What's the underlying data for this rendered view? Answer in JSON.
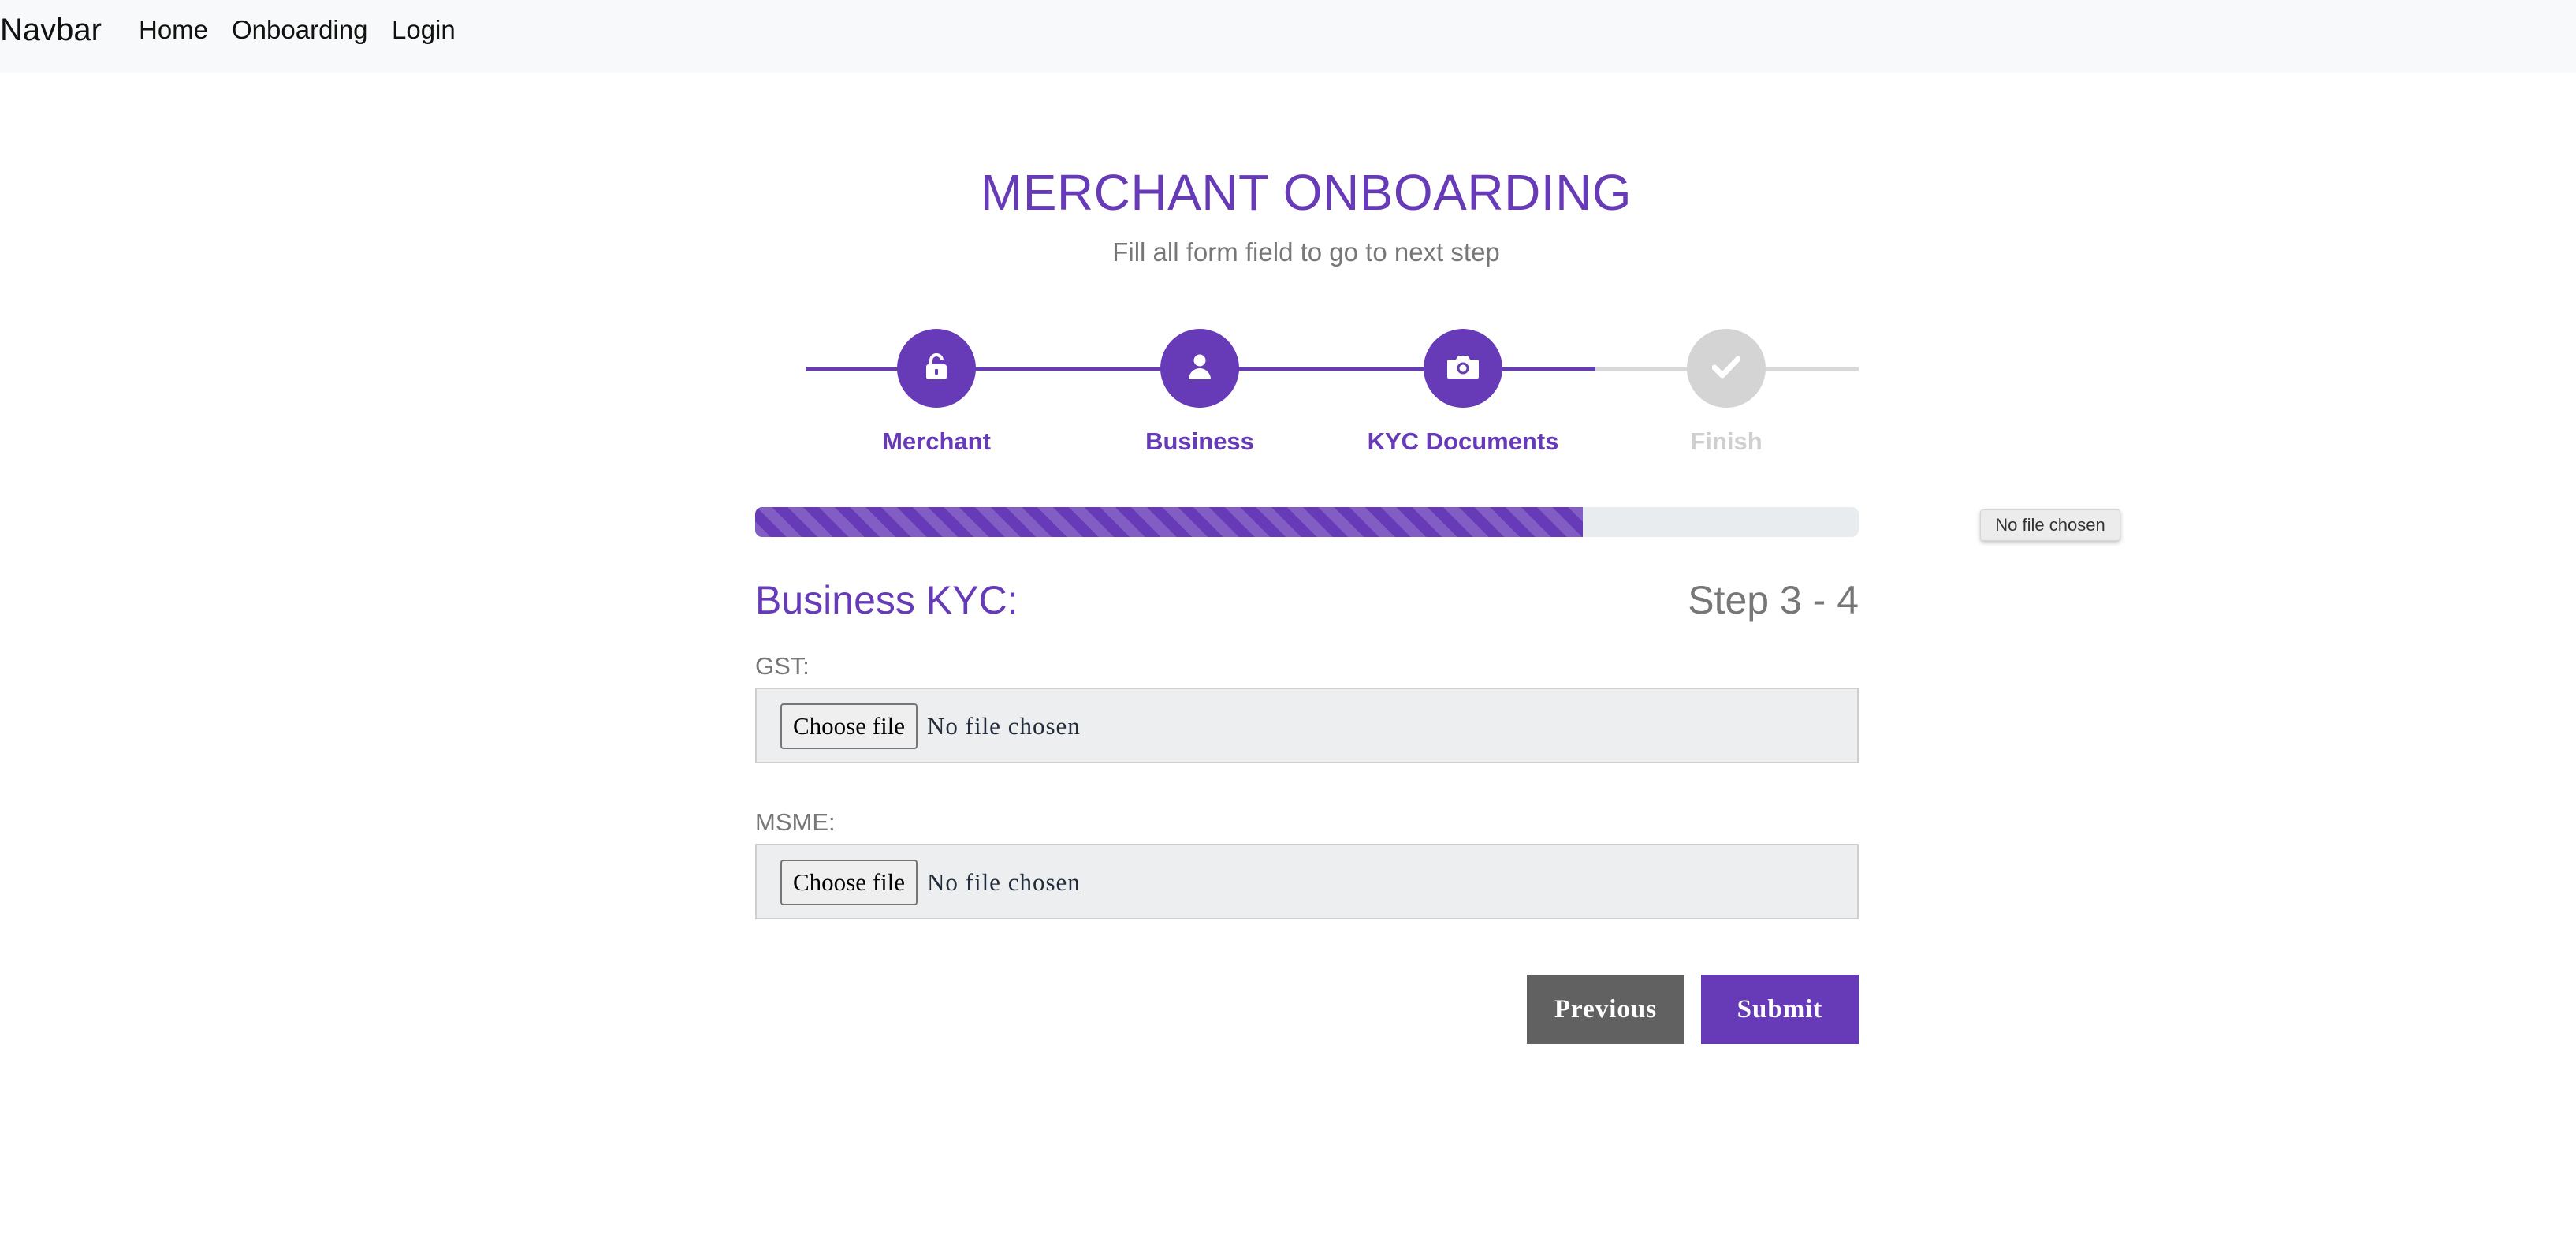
{
  "navbar": {
    "brand": "Navbar",
    "links": [
      "Home",
      "Onboarding",
      "Login"
    ]
  },
  "header": {
    "title": "MERCHANT ONBOARDING",
    "subtitle": "Fill all form field to go to next step"
  },
  "steps": [
    {
      "label": "Merchant",
      "icon": "unlock-icon",
      "status": "done"
    },
    {
      "label": "Business",
      "icon": "user-icon",
      "status": "done"
    },
    {
      "label": "KYC Documents",
      "icon": "camera-icon",
      "status": "done"
    },
    {
      "label": "Finish",
      "icon": "check-icon",
      "status": "todo"
    }
  ],
  "progress": {
    "percent": 75
  },
  "tooltip": "No file chosen",
  "section": {
    "title": "Business KYC:",
    "step_count": "Step 3 - 4"
  },
  "fields": [
    {
      "label": "GST:",
      "button": "Choose file",
      "value": "No file chosen"
    },
    {
      "label": "MSME:",
      "button": "Choose file",
      "value": "No file chosen"
    }
  ],
  "actions": {
    "previous": "Previous",
    "submit": "Submit"
  },
  "colors": {
    "accent": "#673ab7",
    "inactive": "#d4d4d4",
    "previous_button": "#616161"
  }
}
